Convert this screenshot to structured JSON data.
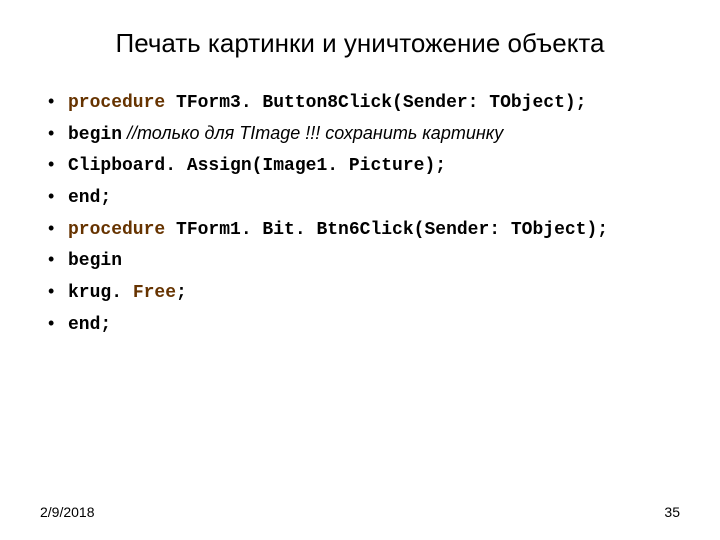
{
  "title": "Печать картинки и уничтожение объекта",
  "lines": {
    "l1a": "procedure",
    "l1b": " TForm3. Button8Click(Sender: TObject);",
    "l2a": "  begin",
    "l2b": "       //только для TImage !!! сохранить картинку",
    "l3": "   Clipboard. Assign(Image1. Picture);",
    "l4": "  end;",
    "l5a": "procedure",
    "l5b": " TForm1. Bit. Btn6Click(Sender: TObject);",
    "l6": "  begin",
    "l7a": "   krug. ",
    "l7b": "Free",
    "l7c": ";",
    "l8": "  end;"
  },
  "footer": {
    "date": "2/9/2018",
    "page": "35"
  }
}
